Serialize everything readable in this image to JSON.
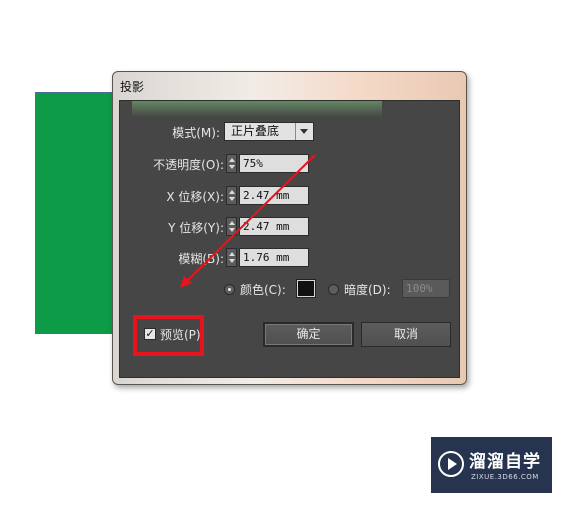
{
  "dialog": {
    "title": "投影",
    "mode": {
      "label": "模式(M):",
      "value": "正片叠底"
    },
    "opacity": {
      "label": "不透明度(O):",
      "value": "75%"
    },
    "x_offset": {
      "label": "X 位移(X):",
      "value": "2.47 mm"
    },
    "y_offset": {
      "label": "Y 位移(Y):",
      "value": "2.47 mm"
    },
    "blur": {
      "label": "模糊(B):",
      "value": "1.76 mm"
    },
    "color_option": {
      "label": "颜色(C):",
      "selected": true,
      "swatch": "#111111"
    },
    "darkness_option": {
      "label": "暗度(D):",
      "selected": false,
      "value": "100%"
    },
    "preview": {
      "label": "预览(P)",
      "checked": true,
      "check_glyph": "✓"
    },
    "ok_button": "确定",
    "cancel_button": "取消"
  },
  "watermark": {
    "brand": "溜溜自学",
    "url": "ZIXUE.3D66.COM"
  },
  "colors": {
    "highlight": "#e8141b",
    "shape_fill": "#0d9b48",
    "panel": "#474646"
  }
}
